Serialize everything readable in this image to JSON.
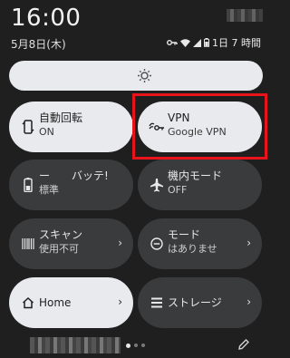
{
  "status": {
    "time": "16:00",
    "date": "5月8日(木)",
    "battery_text": "1日 7 時間"
  },
  "tiles": [
    {
      "title": "自動回転",
      "sub": "ON",
      "state": "on",
      "icon": "auto-rotate-icon"
    },
    {
      "title": "VPN",
      "sub": "Google VPN",
      "state": "on",
      "icon": "vpn-key-icon"
    },
    {
      "title": "ー　　バッテ!",
      "sub": "標準",
      "state": "off",
      "icon": "battery-saver-icon"
    },
    {
      "title": "機内モード",
      "sub": "OFF",
      "state": "off",
      "icon": "airplane-icon"
    },
    {
      "title": "スキャン",
      "sub": "使用不可",
      "state": "off",
      "icon": "qr-scanner-icon",
      "chevron": "›"
    },
    {
      "title": "モード",
      "sub": "はありませ",
      "state": "off",
      "icon": "do-not-disturb-icon",
      "chevron": "›"
    },
    {
      "title": "Home",
      "sub": "",
      "state": "on",
      "icon": "home-icon",
      "chevron": "›"
    },
    {
      "title": "ストレージ",
      "sub": "",
      "state": "off",
      "icon": "storage-icon",
      "chevron": "›"
    }
  ],
  "colors": {
    "background": "#1f1f1f",
    "tile_on": "#e8eaee",
    "tile_off": "#3a3b3d",
    "highlight": "#e8131b"
  },
  "pager": {
    "pages": 3,
    "active": 1
  }
}
